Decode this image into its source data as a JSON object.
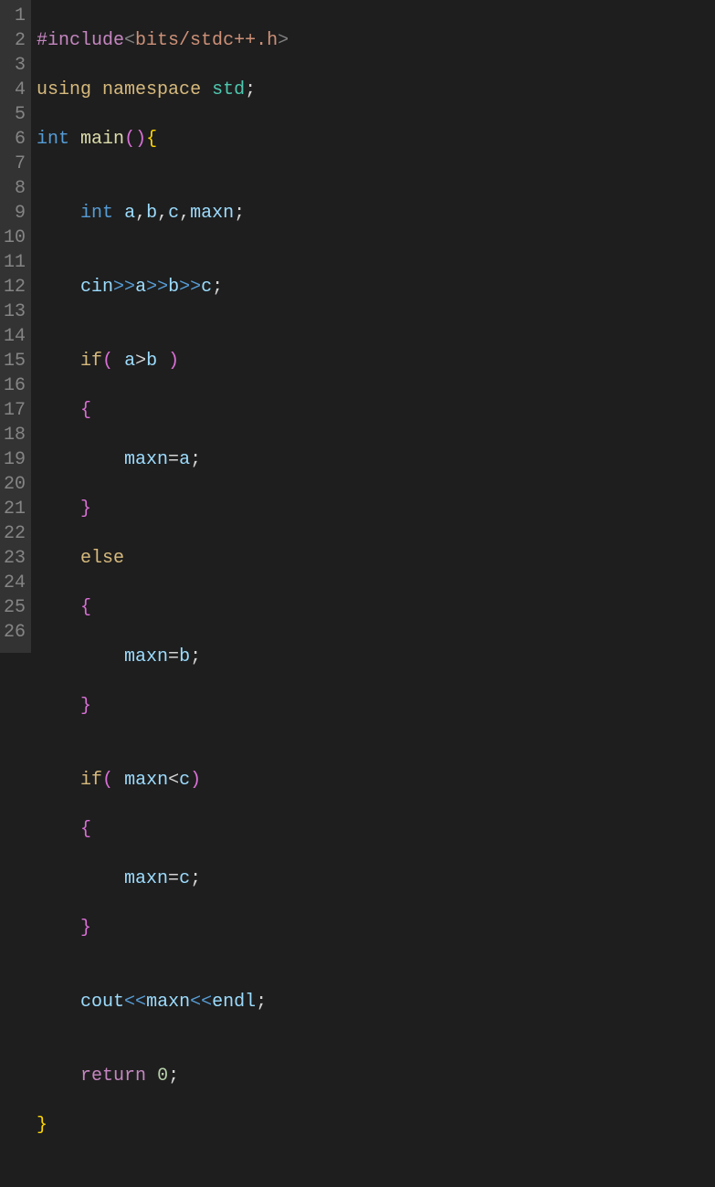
{
  "gutter": {
    "lines": [
      "1",
      "2",
      "3",
      "4",
      "5",
      "6",
      "7",
      "8",
      "9",
      "10",
      "11",
      "12",
      "13",
      "14",
      "15",
      "16",
      "17",
      "18",
      "19",
      "20",
      "21",
      "22",
      "23",
      "24",
      "25",
      "26"
    ]
  },
  "code": {
    "l1": {
      "preproc": "#include",
      "lt": "<",
      "path": "bits/stdc++.h",
      "gt": ">"
    },
    "l2": {
      "using": "using",
      "namespace": "namespace",
      "ns": "std",
      "semi": ";"
    },
    "l3": {
      "type": "int",
      "func": "main",
      "lp": "(",
      "rp": ")",
      "lb": "{"
    },
    "l4": {
      "blank": ""
    },
    "l5": {
      "indent": "    ",
      "type": "int",
      "a": "a",
      "c1": ",",
      "b": "b",
      "c2": ",",
      "c": "c",
      "c3": ",",
      "maxn": "maxn",
      "semi": ";"
    },
    "l6": {
      "blank": ""
    },
    "l7": {
      "indent": "    ",
      "cin": "cin",
      "s1": ">>",
      "a": "a",
      "s2": ">>",
      "b": "b",
      "s3": ">>",
      "c": "c",
      "semi": ";"
    },
    "l8": {
      "blank": ""
    },
    "l9": {
      "indent": "    ",
      "kw": "if",
      "lp": "(",
      "sp": " ",
      "a": "a",
      "op": ">",
      "b": "b",
      "sp2": " ",
      "rp": ")"
    },
    "l10": {
      "indent": "    ",
      "lb": "{"
    },
    "l11": {
      "indent": "        ",
      "maxn": "maxn",
      "eq": "=",
      "a": "a",
      "semi": ";"
    },
    "l12": {
      "indent": "    ",
      "rb": "}"
    },
    "l13": {
      "indent": "    ",
      "kw": "else"
    },
    "l14": {
      "indent": "    ",
      "lb": "{"
    },
    "l15": {
      "indent": "        ",
      "maxn": "maxn",
      "eq": "=",
      "b": "b",
      "semi": ";"
    },
    "l16": {
      "indent": "    ",
      "rb": "}"
    },
    "l17": {
      "blank": ""
    },
    "l18": {
      "indent": "    ",
      "kw": "if",
      "lp": "(",
      "sp": " ",
      "maxn": "maxn",
      "op": "<",
      "c": "c",
      "rp": ")"
    },
    "l19": {
      "indent": "    ",
      "lb": "{"
    },
    "l20": {
      "indent": "        ",
      "maxn": "maxn",
      "eq": "=",
      "c": "c",
      "semi": ";"
    },
    "l21": {
      "indent": "    ",
      "rb": "}"
    },
    "l22": {
      "blank": ""
    },
    "l23": {
      "indent": "    ",
      "cout": "cout",
      "s1": "<<",
      "maxn": "maxn",
      "s2": "<<",
      "endl": "endl",
      "semi": ";"
    },
    "l24": {
      "blank": ""
    },
    "l25": {
      "indent": "    ",
      "kw": "return",
      "sp": " ",
      "num": "0",
      "semi": ";"
    },
    "l26": {
      "rb": "}"
    }
  }
}
